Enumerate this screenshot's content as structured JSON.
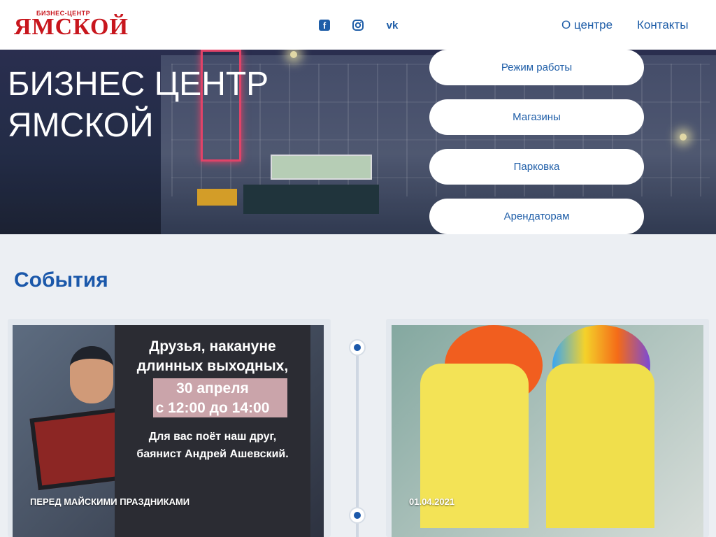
{
  "header": {
    "logo": {
      "small": "БИЗНЕС-ЦЕНТР",
      "big": "ЯМСКОЙ"
    },
    "social": [
      {
        "name": "facebook",
        "icon": "facebook-icon",
        "glyph": "f"
      },
      {
        "name": "instagram",
        "icon": "instagram-icon",
        "glyph": "◎"
      },
      {
        "name": "vk",
        "icon": "vk-icon",
        "glyph": "vk"
      }
    ],
    "nav": [
      "О центре",
      "Контакты"
    ]
  },
  "hero": {
    "title": "БИЗНЕС ЦЕНТР ЯМСКОЙ",
    "menu": [
      "Режим работы",
      "Магазины",
      "Парковка",
      "Арендаторам"
    ]
  },
  "events": {
    "title": "События",
    "items": [
      {
        "caption": "ПЕРЕД МАЙСКИМИ ПРАЗДНИКАМИ",
        "poster": {
          "line1": "Друзья, накануне",
          "line2": "длинных выходных,",
          "line3": "30 апреля",
          "line4": "с 12:00 до 14:00",
          "line5": "Для вас поёт наш друг,",
          "line6": "баянист Андрей Ашевский."
        }
      },
      {
        "caption": "01.04.2021"
      }
    ]
  },
  "colors": {
    "brand_blue": "#1b58aa",
    "logo_red": "#c8161d",
    "background": "#eceff3"
  }
}
